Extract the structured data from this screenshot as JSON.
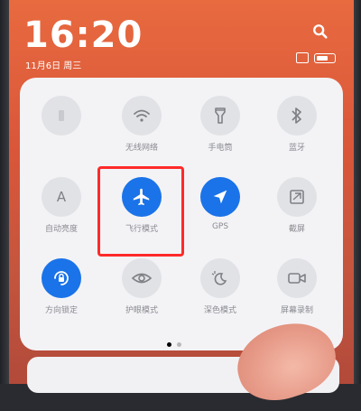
{
  "status": {
    "time": "16:20",
    "date": "11月6日 周三"
  },
  "tiles": [
    {
      "name": "blank",
      "label": "",
      "active": false,
      "dim": true
    },
    {
      "name": "wifi",
      "label": "无线网络",
      "active": false,
      "icon": "wifi-icon"
    },
    {
      "name": "flashlight",
      "label": "手电筒",
      "active": false,
      "icon": "flashlight-icon"
    },
    {
      "name": "bluetooth",
      "label": "蓝牙",
      "active": false,
      "icon": "bluetooth-icon"
    },
    {
      "name": "auto-brightness",
      "label": "自动亮度",
      "active": false,
      "icon": "brightness-a-icon"
    },
    {
      "name": "airplane",
      "label": "飞行模式",
      "active": true,
      "icon": "airplane-icon"
    },
    {
      "name": "gps",
      "label": "GPS",
      "active": true,
      "icon": "location-arrow-icon"
    },
    {
      "name": "screenshot",
      "label": "截屏",
      "active": false,
      "icon": "screenshot-icon"
    },
    {
      "name": "rotation-lock",
      "label": "方向锁定",
      "active": true,
      "icon": "rotation-lock-icon"
    },
    {
      "name": "eye-care",
      "label": "护眼模式",
      "active": false,
      "icon": "eye-icon"
    },
    {
      "name": "dark-mode",
      "label": "深色模式",
      "active": false,
      "icon": "dark-mode-icon"
    },
    {
      "name": "screen-record",
      "label": "屏幕录制",
      "active": false,
      "icon": "video-record-icon"
    }
  ],
  "pager": {
    "pages": 2,
    "current": 1
  },
  "colors": {
    "accent": "#1a73e8",
    "highlight": "#ff2a2a",
    "panel": "#f3f3f6"
  }
}
